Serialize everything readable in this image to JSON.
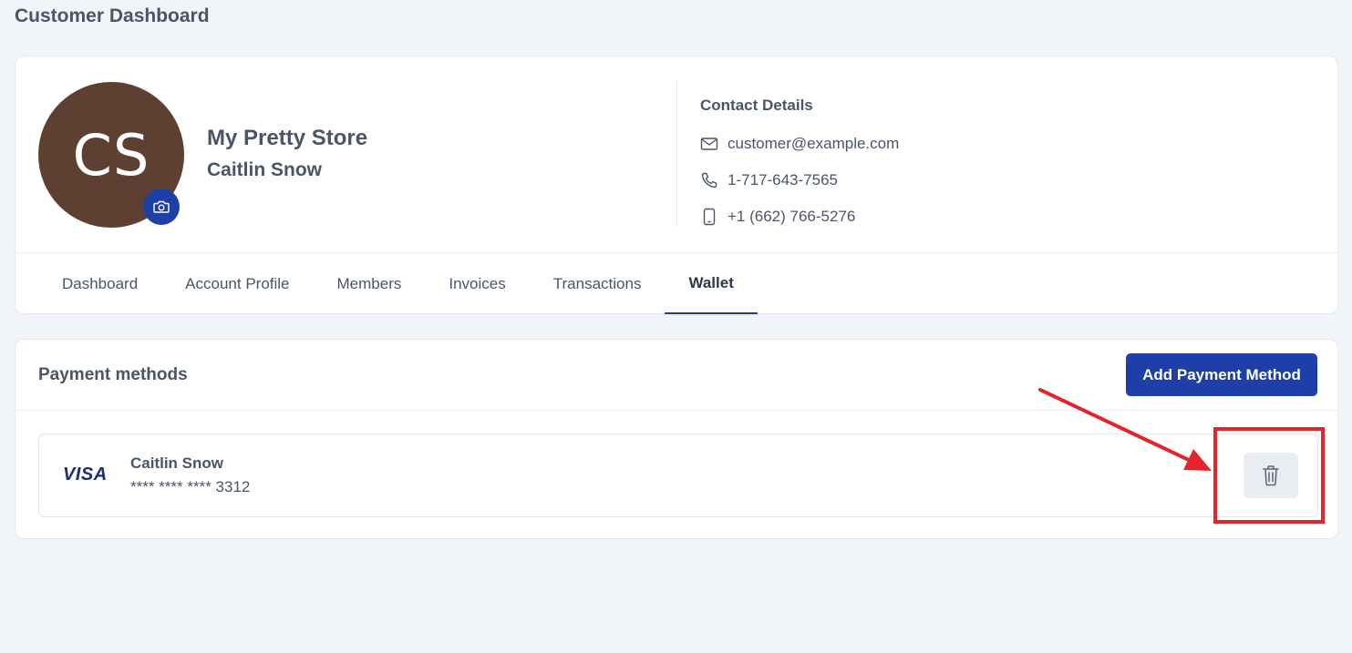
{
  "page": {
    "title": "Customer Dashboard"
  },
  "profile": {
    "initials": "CS",
    "store_name": "My Pretty Store",
    "owner_name": "Caitlin Snow",
    "avatar_color": "#5e4033"
  },
  "contact": {
    "title": "Contact Details",
    "email": "customer@example.com",
    "phone": "1-717-643-7565",
    "mobile": "+1 (662) 766-5276"
  },
  "tabs": [
    {
      "label": "Dashboard",
      "active": false
    },
    {
      "label": "Account Profile",
      "active": false
    },
    {
      "label": "Members",
      "active": false
    },
    {
      "label": "Invoices",
      "active": false
    },
    {
      "label": "Transactions",
      "active": false
    },
    {
      "label": "Wallet",
      "active": true
    }
  ],
  "payment": {
    "title": "Payment methods",
    "add_button_label": "Add Payment Method",
    "methods": [
      {
        "brand": "VISA",
        "holder": "Caitlin Snow",
        "number": "**** **** **** 3312"
      }
    ]
  },
  "colors": {
    "accent": "#1e3fa8",
    "annotation": "#e3242b",
    "background": "#f1f4f9"
  },
  "icons": {
    "camera": "camera-icon",
    "email": "mail-icon",
    "phone": "phone-icon",
    "mobile": "mobile-icon",
    "delete": "trash-icon"
  }
}
